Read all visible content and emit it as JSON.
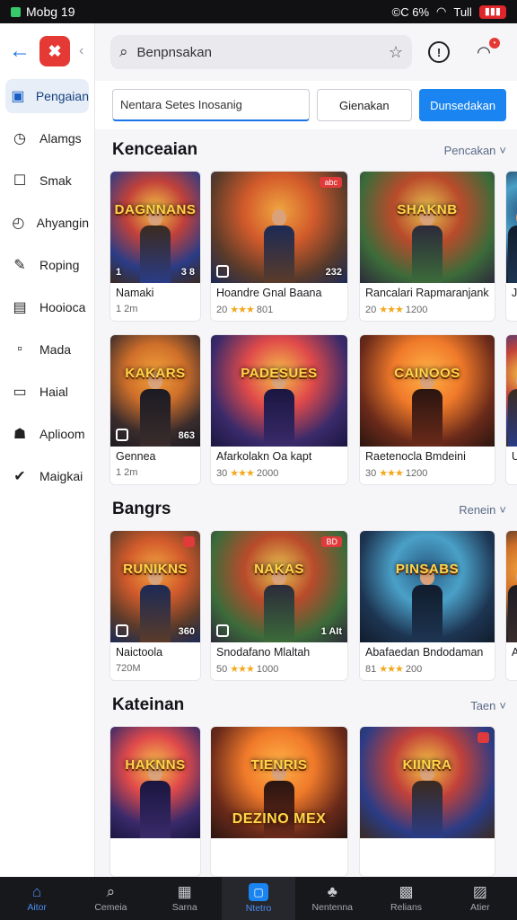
{
  "status": {
    "title": "Mobg 19",
    "right": "©C 6%",
    "signal": "Tull",
    "battery": " "
  },
  "sidebar": {
    "items": [
      {
        "label": "Pengaian",
        "icon": "dashboard-icon",
        "glyph": "▣"
      },
      {
        "label": "Alamgs",
        "icon": "clock-icon",
        "glyph": "◷"
      },
      {
        "label": "Smak",
        "icon": "briefcase-icon",
        "glyph": "☐"
      },
      {
        "label": "Ahyangin",
        "icon": "time-icon",
        "glyph": "◴"
      },
      {
        "label": "Roping",
        "icon": "pen-icon",
        "glyph": "✎"
      },
      {
        "label": "Hooioca",
        "icon": "book-icon",
        "glyph": "▤"
      },
      {
        "label": "Mada",
        "icon": "note-icon",
        "glyph": "▫"
      },
      {
        "label": "Haial",
        "icon": "card-icon",
        "glyph": "▭"
      },
      {
        "label": "Aplioom",
        "icon": "bag-icon",
        "glyph": "☗"
      },
      {
        "label": "Maigkai",
        "icon": "check-circle-icon",
        "glyph": "✔"
      }
    ]
  },
  "topbar": {
    "search_value": "Benpnsakan"
  },
  "filterbar": {
    "input_value": "Nentara Setes  Inosanig",
    "outline_label": "Gienakan",
    "primary_label": "Dunsedakan"
  },
  "sections": [
    {
      "title": "Kenceaian",
      "link": "Pencakan",
      "cards": [
        {
          "art": "DAGNNANS",
          "name": "Namaki",
          "sub": "1 2m",
          "stars": "",
          "rank": "1",
          "num": "3 8",
          "badge": ""
        },
        {
          "art": "",
          "name": "Hoandre Gnal Baana",
          "sub": "20",
          "stars": "★★★",
          "rate": "801",
          "num": "232",
          "badge": "abc"
        },
        {
          "art": "SHAKNB",
          "name": "Rancalari Rapmaranjank",
          "sub": "20",
          "stars": "★★★",
          "rate": "1200",
          "num": "",
          "badge": ""
        },
        {
          "art": "",
          "name": "JI",
          "sub": "",
          "stars": "",
          "num": "",
          "badge": ""
        }
      ]
    },
    {
      "title": "",
      "link": "",
      "cards": [
        {
          "art": "KAKARS",
          "name": "Gennea",
          "sub": "1 2m",
          "stars": "",
          "num": "863",
          "badge": ""
        },
        {
          "art": "PADESUES",
          "name": "Afarkolakn Oa kapt",
          "sub": "30",
          "stars": "★★★",
          "rate": "2000",
          "num": "",
          "badge": ""
        },
        {
          "art": "CAINOOS",
          "name": "Raetenocla Bmdeini",
          "sub": "30",
          "stars": "★★★",
          "rate": "1200",
          "num": "",
          "badge": ""
        },
        {
          "art": "",
          "name": "Ur",
          "sub": "",
          "stars": "",
          "num": "",
          "badge": ""
        }
      ]
    },
    {
      "title": "Bangrs",
      "link": "Renein",
      "cards": [
        {
          "art": "RUNIKNS",
          "name": "Naictoola",
          "sub": "720M",
          "stars": "",
          "num": "360",
          "badge": " "
        },
        {
          "art": "NAKAS",
          "name": "Snodafano Mlaltah",
          "sub": "50",
          "stars": "★★★",
          "rate": "1000",
          "num": "1 AIt",
          "badge": "BD"
        },
        {
          "art": "PINSABS",
          "name": "Abafaedan Bndodaman",
          "sub": "81",
          "stars": "★★★",
          "rate": "200",
          "num": "",
          "badge": ""
        },
        {
          "art": "",
          "name": "Ai",
          "sub": "",
          "stars": "",
          "num": "",
          "badge": ""
        }
      ]
    },
    {
      "title": "Kateinan",
      "link": "Taen",
      "cards": [
        {
          "art": "HAKNNS",
          "name": "",
          "sub": "",
          "stars": "",
          "num": "",
          "badge": ""
        },
        {
          "art": "TIENRIS",
          "name": "",
          "sub": "",
          "stars": "",
          "num": "",
          "badge": "",
          "art2": "DEZINO MEX"
        },
        {
          "art": "KIINRA",
          "name": "",
          "sub": "",
          "stars": "",
          "num": "",
          "badge": " "
        }
      ]
    }
  ],
  "bottomnav": [
    {
      "label": "Aitor",
      "icon": "home-icon",
      "glyph": "⌂"
    },
    {
      "label": "Cemeia",
      "icon": "search-icon",
      "glyph": "⌕"
    },
    {
      "label": "Sarna",
      "icon": "grid-icon",
      "glyph": "▦"
    },
    {
      "label": "Ntetro",
      "icon": "card-icon",
      "glyph": "▢"
    },
    {
      "label": "Nentenna",
      "icon": "tree-icon",
      "glyph": "♣"
    },
    {
      "label": "Relians",
      "icon": "calendar-icon",
      "glyph": "▩"
    },
    {
      "label": "Atier",
      "icon": "monitor-icon",
      "glyph": "▨"
    }
  ],
  "colors": {
    "accent": "#1a84f0",
    "sidebar_active_bg": "#e8eef8",
    "nav_bg": "#17181c",
    "star": "#f2a81e",
    "badge": "#e03a3a"
  }
}
